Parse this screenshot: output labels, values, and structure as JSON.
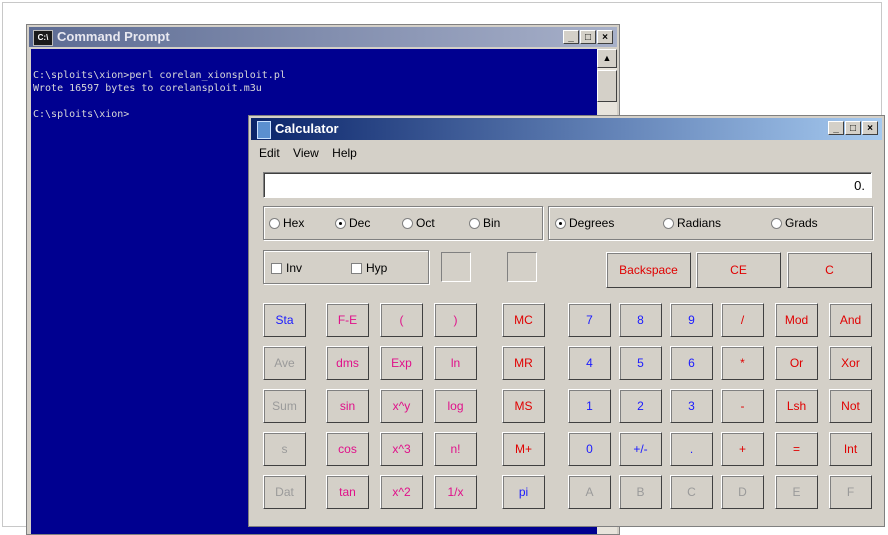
{
  "cmd": {
    "title": "Command Prompt",
    "icon": "cmd-icon",
    "output": "C:\\sploits\\xion>perl corelan_xionsploit.pl\nWrote 16597 bytes to corelansploit.m3u\n\nC:\\sploits\\xion>",
    "buttons": {
      "min": "_",
      "max": "□",
      "close": "×"
    }
  },
  "calc": {
    "title": "Calculator",
    "menu": [
      "Edit",
      "View",
      "Help"
    ],
    "display": "0.",
    "numbase": [
      {
        "label": "Hex",
        "selected": false
      },
      {
        "label": "Dec",
        "selected": true
      },
      {
        "label": "Oct",
        "selected": false
      },
      {
        "label": "Bin",
        "selected": false
      }
    ],
    "angle": [
      {
        "label": "Degrees",
        "selected": true
      },
      {
        "label": "Radians",
        "selected": false
      },
      {
        "label": "Grads",
        "selected": false
      }
    ],
    "checks": [
      "Inv",
      "Hyp"
    ],
    "top_keys": [
      "Backspace",
      "CE",
      "C"
    ],
    "keys": [
      [
        "Sta",
        "F-E",
        "(",
        ")",
        "MC",
        "7",
        "8",
        "9",
        "/",
        "Mod",
        "And"
      ],
      [
        "Ave",
        "dms",
        "Exp",
        "ln",
        "MR",
        "4",
        "5",
        "6",
        "*",
        "Or",
        "Xor"
      ],
      [
        "Sum",
        "sin",
        "x^y",
        "log",
        "MS",
        "1",
        "2",
        "3",
        "-",
        "Lsh",
        "Not"
      ],
      [
        "s",
        "cos",
        "x^3",
        "n!",
        "M+",
        "0",
        "+/-",
        ".",
        "+",
        "=",
        "Int"
      ],
      [
        "Dat",
        "tan",
        "x^2",
        "1/x",
        "pi",
        "A",
        "B",
        "C",
        "D",
        "E",
        "F"
      ]
    ],
    "colors": {
      "blue": "#1a1aff",
      "red": "#e00000",
      "magenta": "#e0108a",
      "grey": "#9a9a9a"
    }
  }
}
